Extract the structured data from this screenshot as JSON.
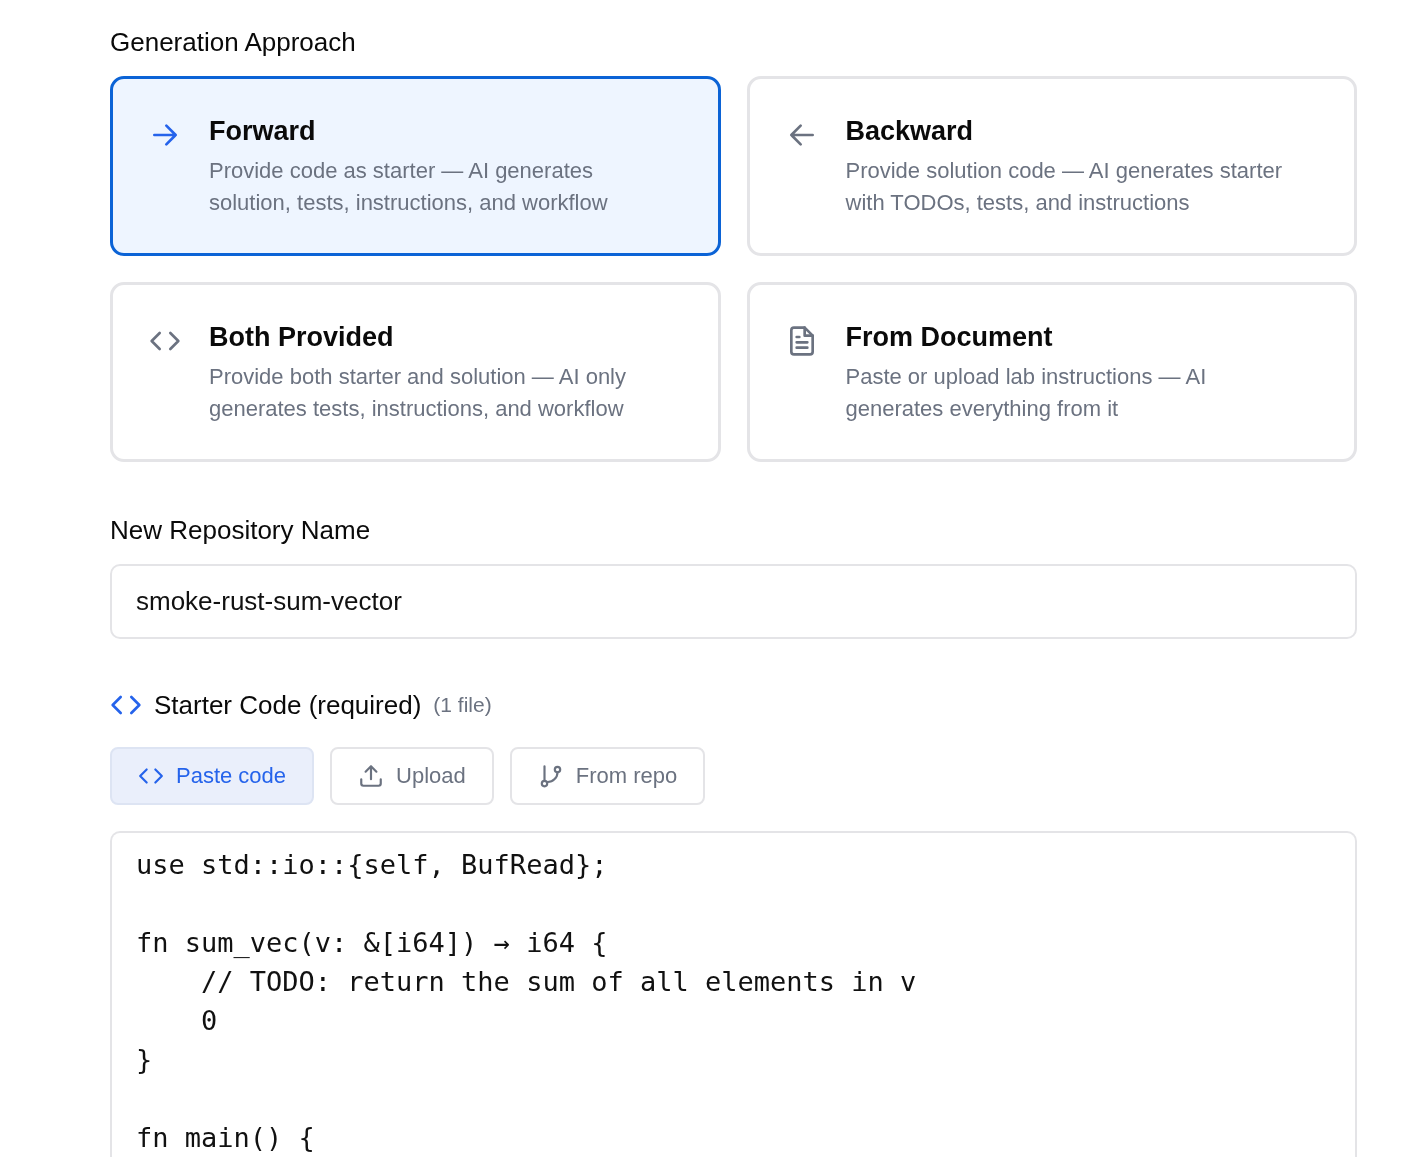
{
  "generation_approach": {
    "label": "Generation Approach",
    "options": [
      {
        "kind": "arrow-right",
        "title": "Forward",
        "description": "Provide code as starter — AI generates solution, tests, instructions, and workflow",
        "selected": true
      },
      {
        "kind": "arrow-left",
        "title": "Backward",
        "description": "Provide solution code — AI generates starter with TODOs, tests, and instructions",
        "selected": false
      },
      {
        "kind": "code",
        "title": "Both Provided",
        "description": "Provide both starter and solution — AI only generates tests, instructions, and workflow",
        "selected": false
      },
      {
        "kind": "document",
        "title": "From Document",
        "description": "Paste or upload lab instructions — AI generates everything from it",
        "selected": false
      }
    ]
  },
  "repository_name": {
    "label": "New Repository Name",
    "value": "smoke-rust-sum-vector"
  },
  "starter_code": {
    "label": "Starter Code (required)",
    "count": "(1 file)",
    "sources": [
      {
        "kind": "code",
        "label": "Paste code",
        "selected": true
      },
      {
        "kind": "upload",
        "label": "Upload",
        "selected": false
      },
      {
        "kind": "branch",
        "label": "From repo",
        "selected": false
      }
    ],
    "code_blocks": [
      [
        "use std::io::{self, BufRead};"
      ],
      [
        "fn sum_vec(v: &[i64]) → i64 {",
        "    // TODO: return the sum of all elements in v",
        "    0",
        "}"
      ],
      [
        "fn main() {"
      ]
    ]
  }
}
